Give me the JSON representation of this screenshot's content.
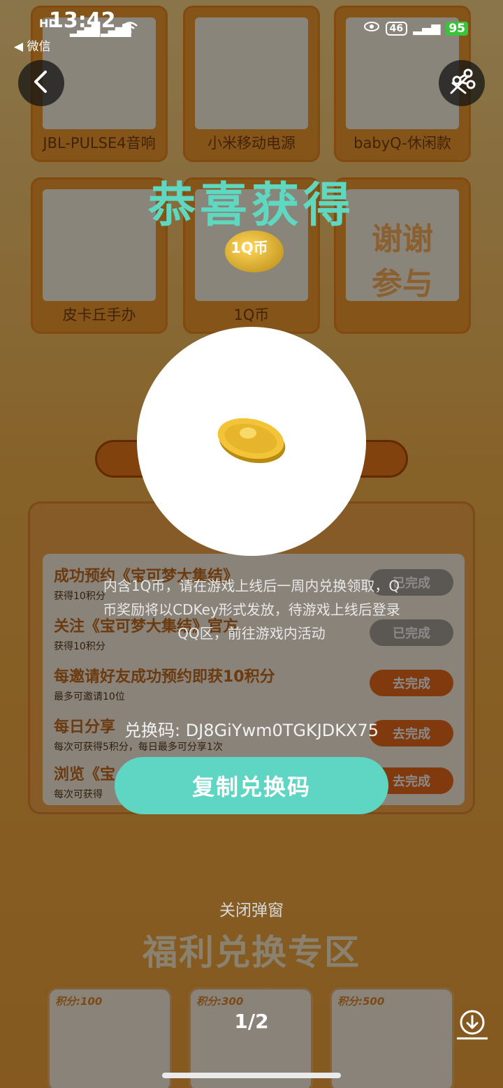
{
  "status_bar": {
    "time": "13:42",
    "carrier": "HD",
    "back_app": "◀ 微信",
    "network": "46",
    "battery": "95"
  },
  "background": {
    "prizes": [
      {
        "name": "JBL-PULSE4音响"
      },
      {
        "name": "小米移动电源"
      },
      {
        "name": "babyQ-休闲款"
      },
      {
        "name": "皮卡丘手办"
      },
      {
        "name": "1Q币"
      },
      {
        "name": "谢谢参与"
      }
    ],
    "tasks": [
      {
        "title": "成功预约《宝可梦大集结》",
        "sub": "获得10积分",
        "button": "已完成"
      },
      {
        "title": "关注《宝可梦大集结》官方",
        "sub": "获得10积分",
        "button": "已完成"
      },
      {
        "title": "每邀请好友成功预约即获10积分",
        "sub": "最多可邀请10位",
        "button": "去完成"
      },
      {
        "title": "每日分享",
        "sub": "每次可获得5积分，每日最多可分享1次",
        "button": "去完成"
      },
      {
        "title": "浏览《宝",
        "sub": "每次可获得",
        "button": "去完成"
      }
    ],
    "welfare_title": "福利兑换专区",
    "shop": [
      {
        "price": "积分:100"
      },
      {
        "price": "积分:300"
      },
      {
        "price": "积分:500"
      }
    ]
  },
  "modal": {
    "title": "恭喜获得",
    "prize_label": "1Q币",
    "description": "内含1Q币，请在游戏上线后一周内兑换领取，Q币奖励将以CDKey形式发放，待游戏上线后登录QQ区，前往游戏内活动",
    "code_text": "兑换码: DJ8GiYwm0TGKJDKX75",
    "copy_button": "复制兑换码",
    "close_text": "关闭弹窗"
  },
  "viewer": {
    "pager": "1/2"
  },
  "colors": {
    "accent": "#5fd5c4",
    "title": "#5fd8c2",
    "background": "#f7b64a"
  }
}
